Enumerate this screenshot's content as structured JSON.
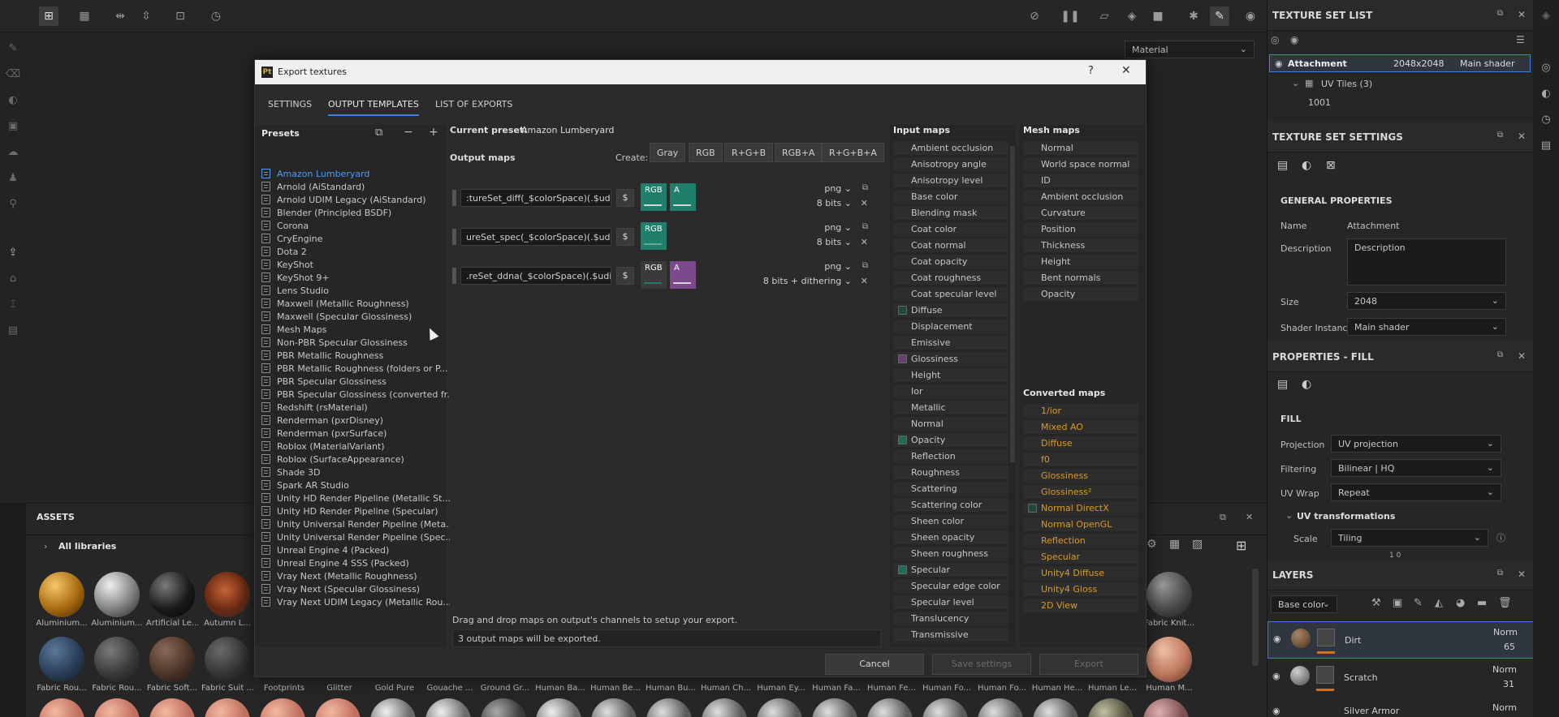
{
  "viewport": {
    "material_select": "Material"
  },
  "texture_set_list": {
    "title": "TEXTURE SET LIST",
    "set_name": "Attachment",
    "set_size": "2048x2048",
    "set_shader": "Main shader",
    "uv_tiles": "UV Tiles (3)",
    "tile": "1001"
  },
  "texture_set_settings": {
    "title": "TEXTURE SET SETTINGS",
    "section": "GENERAL PROPERTIES",
    "name_label": "Name",
    "name_value": "Attachment",
    "desc_label": "Description",
    "desc_value": "Description",
    "size_label": "Size",
    "size_value": "2048",
    "shader_label": "Shader Instance",
    "shader_value": "Main shader"
  },
  "properties_fill": {
    "title": "PROPERTIES - FILL",
    "section": "FILL",
    "projection_label": "Projection",
    "projection_value": "UV projection",
    "filtering_label": "Filtering",
    "filtering_value": "Bilinear | HQ",
    "uvwrap_label": "UV Wrap",
    "uvwrap_value": "Repeat",
    "uvt_label": "UV transformations",
    "scale_label": "Scale",
    "scale_value": "Tiling",
    "scale_nums": "1   0"
  },
  "layers": {
    "title": "LAYERS",
    "channel": "Base color",
    "items": [
      {
        "name": "Dirt",
        "blend": "Norm",
        "opacity": "65"
      },
      {
        "name": "Scratch",
        "blend": "Norm",
        "opacity": "31"
      },
      {
        "name": "Silver Armor",
        "blend": "Norm",
        "opacity": ""
      }
    ]
  },
  "assets": {
    "title": "ASSETS",
    "library": "All libraries",
    "row1": [
      "Aluminium...",
      "Aluminium...",
      "Artificial Le...",
      "Autumn L...",
      "Fabric Knit..."
    ],
    "row2": [
      "Fabric Rou...",
      "Fabric Rou...",
      "Fabric Soft...",
      "Fabric Suit ...",
      "Footprints",
      "Glitter",
      "Gold Pure",
      "Gouache ...",
      "Ground Gr...",
      "Human Ba...",
      "Human Be...",
      "Human Bu...",
      "Human Ch...",
      "Human Ey...",
      "Human Fa...",
      "Human Fe...",
      "Human Fo...",
      "Human Fo...",
      "Human He...",
      "Human Le...",
      "Human M..."
    ]
  },
  "dialog": {
    "title": "Export textures",
    "help": "?",
    "tabs": [
      "SETTINGS",
      "OUTPUT TEMPLATES",
      "LIST OF EXPORTS"
    ],
    "presets_title": "Presets",
    "presets": [
      "Amazon Lumberyard",
      "Arnold (AiStandard)",
      "Arnold UDIM Legacy (AiStandard)",
      "Blender (Principled BSDF)",
      "Corona",
      "CryEngine",
      "Dota 2",
      "KeyShot",
      "KeyShot 9+",
      "Lens Studio",
      "Maxwell (Metallic Roughness)",
      "Maxwell (Specular Glossiness)",
      "Mesh Maps",
      "Non-PBR Specular Glossiness",
      "PBR Metallic Roughness",
      "PBR Metallic Roughness (folders or P...",
      "PBR Specular Glossiness",
      "PBR Specular Glossiness (converted fr...",
      "Redshift (rsMaterial)",
      "Renderman (pxrDisney)",
      "Renderman (pxrSurface)",
      "Roblox (MaterialVariant)",
      "Roblox (SurfaceAppearance)",
      "Shade 3D",
      "Spark AR Studio",
      "Unity HD Render Pipeline (Metallic St...",
      "Unity HD Render Pipeline (Specular)",
      "Unity Universal Render Pipeline (Meta...",
      "Unity Universal Render Pipeline (Spec...",
      "Unreal Engine 4 (Packed)",
      "Unreal Engine 4 SSS (Packed)",
      "Vray Next (Metallic Roughness)",
      "Vray Next (Specular Glossiness)",
      "Vray Next UDIM Legacy (Metallic Rou..."
    ],
    "current_preset_label": "Current preset:",
    "current_preset": "Amazon Lumberyard",
    "output_maps_title": "Output maps",
    "create_label": "Create:",
    "create_buttons": [
      "Gray",
      "RGB",
      "R+G+B",
      "RGB+A",
      "R+G+B+A"
    ],
    "output_maps": [
      {
        "name": ":tureSet_diff(_$colorSpace)(.$udim)",
        "dollar": "$",
        "format": "png",
        "bits": "8 bits"
      },
      {
        "name": "ureSet_spec(_$colorSpace)(.$udim)",
        "dollar": "$",
        "format": "png",
        "bits": "8 bits"
      },
      {
        "name": ".reSet_ddna(_$colorSpace)(.$udim)",
        "dollar": "$",
        "format": "png",
        "bits": "8 bits + dithering"
      }
    ],
    "channel_labels": {
      "rgb": "RGB",
      "a": "A"
    },
    "drag_hint": "Drag and drop maps on output's channels to setup your export.",
    "export_count": "3 output maps will be exported.",
    "input_maps_title": "Input maps",
    "input_maps": [
      "Ambient occlusion",
      "Anisotropy angle",
      "Anisotropy level",
      "Base color",
      "Blending mask",
      "Coat color",
      "Coat normal",
      "Coat opacity",
      "Coat roughness",
      "Coat specular level",
      "Diffuse",
      "Displacement",
      "Emissive",
      "Glossiness",
      "Height",
      "Ior",
      "Metallic",
      "Normal",
      "Opacity",
      "Reflection",
      "Roughness",
      "Scattering",
      "Scattering color",
      "Sheen color",
      "Sheen opacity",
      "Sheen roughness",
      "Specular",
      "Specular edge color",
      "Specular level",
      "Translucency",
      "Transmissive"
    ],
    "mesh_maps_title": "Mesh maps",
    "mesh_maps": [
      "Normal",
      "World space normal",
      "ID",
      "Ambient occlusion",
      "Curvature",
      "Position",
      "Thickness",
      "Height",
      "Bent normals",
      "Opacity"
    ],
    "converted_maps_title": "Converted maps",
    "converted_maps": [
      "1/ior",
      "Mixed AO",
      "Diffuse",
      "f0",
      "Glossiness",
      "Glossiness²",
      "Normal DirectX",
      "Normal OpenGL",
      "Reflection",
      "Specular",
      "Unity4 Diffuse",
      "Unity4 Gloss",
      "2D View"
    ],
    "cancel": "Cancel",
    "save_settings": "Save settings",
    "export": "Export"
  },
  "colors": {
    "accent": "#3f7ee8",
    "selected_preset": "#4c9cf5",
    "converted": "#d79b2b",
    "chan_teal": "#1f7f6b",
    "chan_purple": "#7c4a8a"
  }
}
